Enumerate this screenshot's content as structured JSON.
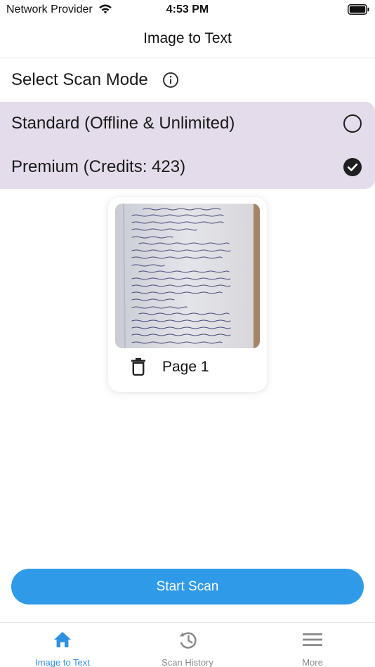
{
  "status_bar": {
    "carrier": "Network Provider",
    "time": "4:53 PM",
    "wifi_icon": "wifi-icon",
    "battery_icon": "battery-icon"
  },
  "nav": {
    "title": "Image to Text"
  },
  "scan_mode": {
    "label": "Select Scan Mode",
    "info_icon": "info-icon",
    "options": [
      {
        "label": "Standard (Offline & Unlimited)",
        "selected": false
      },
      {
        "label": "Premium (Credits: 423)",
        "selected": true
      }
    ],
    "panel_color": "#e4dcea"
  },
  "pages": [
    {
      "label": "Page 1",
      "delete_icon": "trash-icon"
    }
  ],
  "actions": {
    "start_scan": "Start Scan",
    "button_color": "#2f9be8"
  },
  "tab_bar": {
    "active_color": "#2f8fe0",
    "tabs": [
      {
        "label": "Image to Text",
        "icon": "home-icon",
        "active": true
      },
      {
        "label": "Scan History",
        "icon": "history-icon",
        "active": false
      },
      {
        "label": "More",
        "icon": "menu-icon",
        "active": false
      }
    ]
  }
}
